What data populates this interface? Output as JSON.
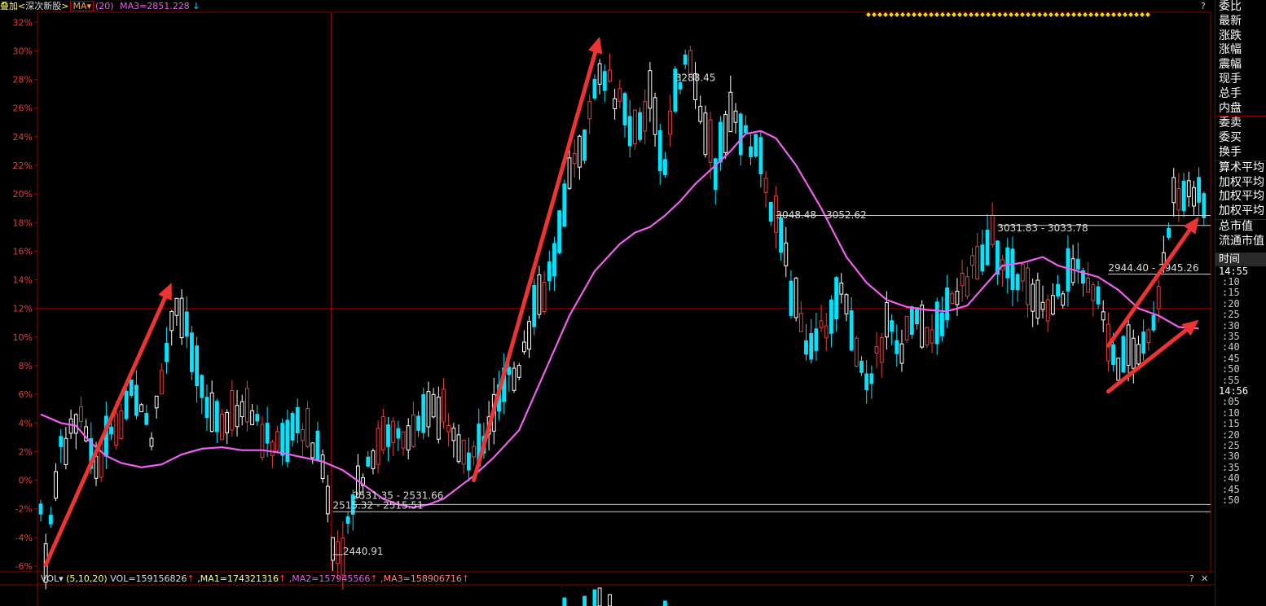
{
  "header": {
    "overlay_label": "叠加<",
    "index_name": "深次新股",
    "close_bracket": ">",
    "ma_button": "MA▾",
    "ma_period": "(20)",
    "ma_value": "MA3=2851.228",
    "arrow": "↓",
    "help": "?"
  },
  "right_panel": {
    "fields": [
      "委比",
      "最新",
      "涨跌",
      "涨幅",
      "震幅",
      "现手",
      "总手",
      "内盘",
      "委卖",
      "委买",
      "换手",
      "算术平均",
      "加权平均",
      "加权平均",
      "加权平均",
      "总市值",
      "流通市值"
    ],
    "time_header": "时间",
    "times": [
      "14:55",
      ":10",
      ":15",
      ":20",
      ":25",
      ":30",
      ":35",
      ":40",
      ":45",
      ":50",
      ":55",
      "14:56",
      ":05",
      ":10",
      ":15",
      ":20",
      ":25",
      ":30",
      ":35",
      ":40",
      ":45",
      ":50"
    ]
  },
  "volume_bar": {
    "label": "VOL▾",
    "params": "(5,10,20)",
    "vol": "VOL=159156826",
    "ma1": ",MA1=174321316",
    "ma2": ",MA2=157945566",
    "ma3": ",MA3=158906716",
    "up_arrow": "↑",
    "help": "?",
    "close": "✕"
  },
  "chart_data": {
    "type": "candlestick",
    "y_axis_ticks": [
      "32%",
      "30%",
      "28%",
      "26%",
      "24%",
      "22%",
      "20%",
      "18%",
      "16%",
      "14%",
      "12%",
      "10%",
      "8%",
      "6%",
      "4%",
      "2%",
      "0%",
      "-2%",
      "-4%",
      "-6%"
    ],
    "ylim": [
      -6.4,
      32.7
    ],
    "ma_series": [
      [
        0,
        4.6
      ],
      [
        4,
        4.0
      ],
      [
        7,
        3.8
      ],
      [
        10,
        2.6
      ],
      [
        13,
        1.7
      ],
      [
        16,
        1.2
      ],
      [
        20,
        0.9
      ],
      [
        24,
        1.1
      ],
      [
        28,
        1.8
      ],
      [
        32,
        2.2
      ],
      [
        36,
        2.3
      ],
      [
        40,
        2.1
      ],
      [
        44,
        2.1
      ],
      [
        48,
        1.9
      ],
      [
        52,
        1.6
      ],
      [
        56,
        1.3
      ],
      [
        60,
        0.7
      ],
      [
        64,
        -0.3
      ],
      [
        68,
        -1.3
      ],
      [
        71,
        -1.7
      ],
      [
        74,
        -1.9
      ],
      [
        77,
        -1.7
      ],
      [
        80,
        -1.3
      ],
      [
        83,
        -0.5
      ],
      [
        86,
        0.3
      ],
      [
        90,
        1.6
      ],
      [
        95,
        3.5
      ],
      [
        100,
        7.5
      ],
      [
        105,
        11.5
      ],
      [
        110,
        14.6
      ],
      [
        115,
        16.5
      ],
      [
        118,
        17.3
      ],
      [
        121,
        17.7
      ],
      [
        124,
        18.5
      ],
      [
        127,
        19.5
      ],
      [
        130,
        20.7
      ],
      [
        134,
        22.0
      ],
      [
        137,
        23.0
      ],
      [
        140,
        24.2
      ],
      [
        143,
        24.4
      ],
      [
        146,
        23.9
      ],
      [
        150,
        22.0
      ],
      [
        155,
        19.0
      ],
      [
        160,
        15.6
      ],
      [
        164,
        13.8
      ],
      [
        168,
        12.6
      ],
      [
        172,
        12.1
      ],
      [
        176,
        11.9
      ],
      [
        180,
        11.8
      ],
      [
        184,
        12.2
      ],
      [
        188,
        13.8
      ],
      [
        191,
        15.0
      ],
      [
        195,
        15.2
      ],
      [
        199,
        15.6
      ],
      [
        202,
        15.0
      ],
      [
        206,
        14.6
      ],
      [
        210,
        14.2
      ],
      [
        214,
        13.3
      ],
      [
        218,
        12.0
      ],
      [
        222,
        11.5
      ],
      [
        226,
        10.7
      ],
      [
        230,
        10.6
      ]
    ],
    "candle_count": 232,
    "annotations": [
      {
        "text": "3288.45",
        "i": 126,
        "y": 27.9
      },
      {
        "text": "3048.48 - 3052.62",
        "i": 146,
        "y": 18.3
      },
      {
        "text": "3031.83 - 3033.78",
        "i": 190,
        "y": 17.4
      },
      {
        "text": "2944.40 - 2945.26",
        "i": 212,
        "y": 14.6
      },
      {
        "text": "2531.35 - 2531.66",
        "i": 62,
        "y": -1.3
      },
      {
        "text": "2515.32 - 2515.51",
        "i": 58,
        "y": -2.0
      },
      {
        "text": "2440.91",
        "i": 60,
        "y": -5.2
      }
    ],
    "horizontal_lines": [
      {
        "y": 18.5,
        "from_i": 146
      },
      {
        "y": 17.8,
        "from_i": 190
      },
      {
        "y": 14.4,
        "from_i": 212
      },
      {
        "y": -1.7,
        "from_i": 62
      },
      {
        "y": -2.2,
        "from_i": 58
      }
    ],
    "arrows": [
      [
        [
          1,
          -5.9
        ],
        [
          26,
          13.8
        ]
      ],
      [
        [
          86,
          0.0
        ],
        [
          111,
          31.0
        ]
      ],
      [
        [
          212,
          9.4
        ],
        [
          230,
          18.4
        ]
      ],
      [
        [
          212,
          6.2
        ],
        [
          230,
          11.2
        ]
      ]
    ],
    "grid_y": [
      12
    ],
    "grid_x_i": [
      58
    ]
  }
}
